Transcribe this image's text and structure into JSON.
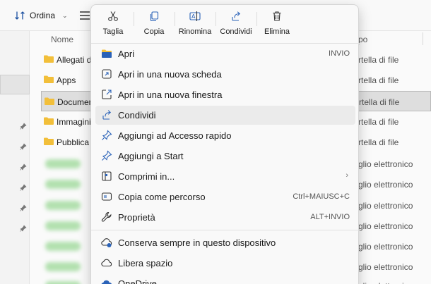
{
  "toolbar": {
    "sort_label": "Ordina"
  },
  "columns": {
    "name": "Nome",
    "type": "po"
  },
  "files": [
    {
      "name": "Allegati d",
      "type": "rtella di file",
      "blurred": false
    },
    {
      "name": "Apps",
      "type": "rtella di file",
      "blurred": false
    },
    {
      "name": "Document",
      "type": "rtella di file",
      "blurred": false,
      "selected": true
    },
    {
      "name": "Immagini",
      "type": "rtella di file",
      "blurred": false
    },
    {
      "name": "Pubblica",
      "type": "rtella di file",
      "blurred": false
    },
    {
      "name": "",
      "type": "glio elettronico",
      "blurred": true
    },
    {
      "name": "",
      "type": "glio elettronico",
      "blurred": true
    },
    {
      "name": "",
      "type": "glio elettronico",
      "blurred": true
    },
    {
      "name": "",
      "type": "glio elettronico",
      "blurred": true
    },
    {
      "name": "",
      "type": "glio elettronico",
      "blurred": true
    },
    {
      "name": "",
      "type": "glio elettronico",
      "blurred": true
    },
    {
      "name": "",
      "type": "glio elettronico",
      "blurred": true
    }
  ],
  "menu": {
    "actions": [
      {
        "label": "Taglia",
        "icon": "scissors-icon"
      },
      {
        "label": "Copia",
        "icon": "copy-icon"
      },
      {
        "label": "Rinomina",
        "icon": "rename-icon"
      },
      {
        "label": "Condividi",
        "icon": "share-icon"
      },
      {
        "label": "Elimina",
        "icon": "trash-icon"
      }
    ],
    "items": [
      {
        "label": "Apri",
        "shortcut": "INVIO",
        "icon": "folder-open-icon"
      },
      {
        "label": "Apri in una nuova scheda",
        "shortcut": "",
        "icon": "new-tab-icon"
      },
      {
        "label": "Apri in una nuova finestra",
        "shortcut": "",
        "icon": "new-window-icon"
      },
      {
        "label": "Condividi",
        "shortcut": "",
        "icon": "share-icon",
        "highlighted": true
      },
      {
        "label": "Aggiungi ad Accesso rapido",
        "shortcut": "",
        "icon": "pin-icon"
      },
      {
        "label": "Aggiungi a Start",
        "shortcut": "",
        "icon": "pin-start-icon"
      },
      {
        "label": "Comprimi in...",
        "shortcut": "",
        "icon": "archive-icon",
        "submenu": true
      },
      {
        "label": "Copia come percorso",
        "shortcut": "Ctrl+MAIUSC+C",
        "icon": "copy-path-icon"
      },
      {
        "label": "Proprietà",
        "shortcut": "ALT+INVIO",
        "icon": "wrench-icon"
      },
      {
        "label": "Conserva sempre in questo dispositivo",
        "shortcut": "",
        "icon": "cloud-keep-icon"
      },
      {
        "label": "Libera spazio",
        "shortcut": "",
        "icon": "cloud-icon"
      },
      {
        "label": "OneDrive",
        "shortcut": "",
        "icon": "onedrive-icon"
      }
    ]
  }
}
